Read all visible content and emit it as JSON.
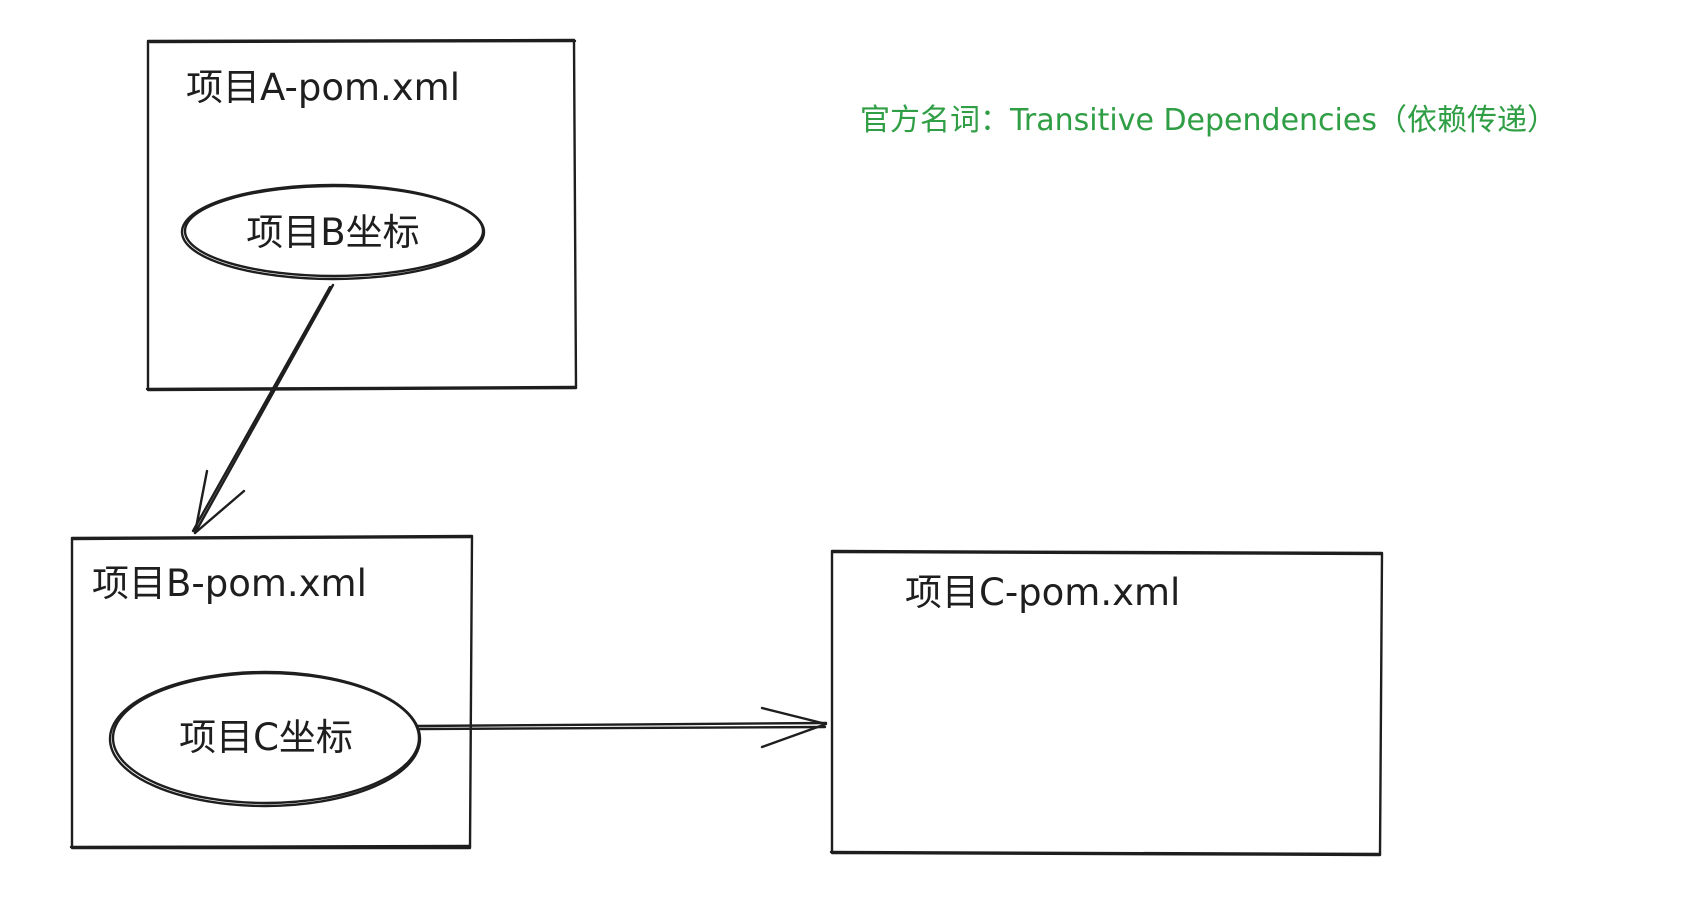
{
  "diagram": {
    "note": {
      "text": "官方名词：Transitive Dependencies（依赖传递）",
      "color": "#2f9e44"
    },
    "project_a": {
      "title": "项目A-pom.xml",
      "coordinate": "项目B坐标"
    },
    "project_b": {
      "title": "项目B-pom.xml",
      "coordinate": "项目C坐标"
    },
    "project_c": {
      "title": "项目C-pom.xml"
    },
    "stroke_color": "#1e1e1e"
  }
}
